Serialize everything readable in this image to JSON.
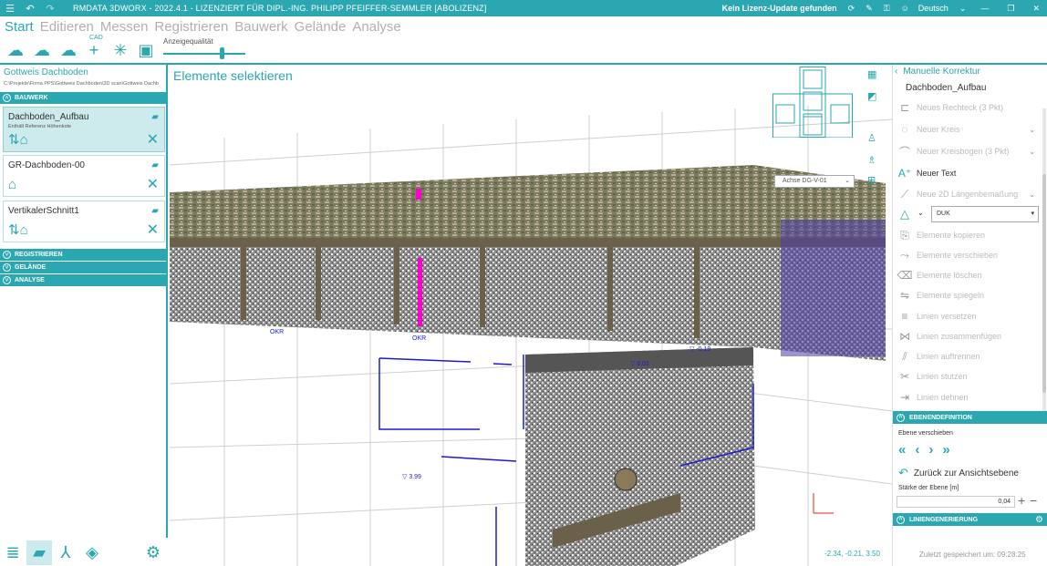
{
  "titlebar": {
    "title": "RMDATA 3DWORX - 2022.4.1 - LIZENZIERT FÜR DIPL.-ING. PHILIPP PFEIFFER-SEMMLER [ABOLIZENZ]",
    "license_status": "Kein Lizenz-Update gefunden",
    "language": "Deutsch"
  },
  "menu": {
    "tabs": [
      "Start",
      "Editieren",
      "Messen",
      "Registrieren",
      "Bauwerk",
      "Gelände",
      "Analyse"
    ],
    "active": "Start"
  },
  "toolbar": {
    "cad_label": "CAD",
    "quality_label": "Anzeigequalität",
    "quality_level": 0.72
  },
  "left": {
    "project_title": "Gottweis Dachboden",
    "project_path": "C:\\Projekte\\Firma PPS\\Gottweis Dachboden\\3D scan\\Gottweis Dachb",
    "section_bauwerk": "BAUWERK",
    "cards": [
      {
        "name": "Dachboden_Aufbau",
        "sub": "Enthält Referenz Höhenkote"
      },
      {
        "name": "GR-Dachboden-00",
        "sub": ""
      },
      {
        "name": "VertikalerSchnitt1",
        "sub": ""
      }
    ],
    "section_registrieren": "REGISTRIEREN",
    "section_gelaende": "GELÄNDE",
    "section_analyse": "ANALYSE"
  },
  "viewport": {
    "title": "Elemente selektieren",
    "axis": "Achse DG-V-01",
    "coords": "-2.34, -0.21, 3.50"
  },
  "right": {
    "header": "Manuelle Korrektur",
    "layer": "Dachboden_Aufbau",
    "tools": [
      {
        "label": "Neues Rechteck (3 Pkt)",
        "enabled": false
      },
      {
        "label": "Neuer Kreis",
        "enabled": false
      },
      {
        "label": "Neuer Kreisbogen (3 Pkt)",
        "enabled": false
      },
      {
        "label": "Neuer Text",
        "enabled": true
      },
      {
        "label": "Neue 2D Längenbemaßung",
        "enabled": false
      },
      {
        "label": "Elemente kopieren",
        "enabled": false
      },
      {
        "label": "Elemente verschieben",
        "enabled": false
      },
      {
        "label": "Elemente löschen",
        "enabled": false
      },
      {
        "label": "Elemente spiegeln",
        "enabled": false
      },
      {
        "label": "Linien versetzen",
        "enabled": false
      },
      {
        "label": "Linien zusammenfügen",
        "enabled": false
      },
      {
        "label": "Linien auftrennen",
        "enabled": false
      },
      {
        "label": "Linien stutzen",
        "enabled": false
      },
      {
        "label": "Linien dehnen",
        "enabled": false
      }
    ],
    "line_type": "DUK",
    "section_ebene": "EBENENDEFINITION",
    "ebene_verschieben": "Ebene verschieben",
    "back_to_view": "Zurück zur Ansichtsebene",
    "thickness_label": "Stärke der Ebene [m]",
    "thickness_value": "0,04",
    "section_linien": "LINIENGENERIERUNG",
    "saved": "Zuletzt gespeichert um: 09:28:25"
  },
  "annotations": [
    "▽ 3.99",
    "▽ -0.19",
    "▽ 0.01",
    "OKR",
    "OKR"
  ]
}
